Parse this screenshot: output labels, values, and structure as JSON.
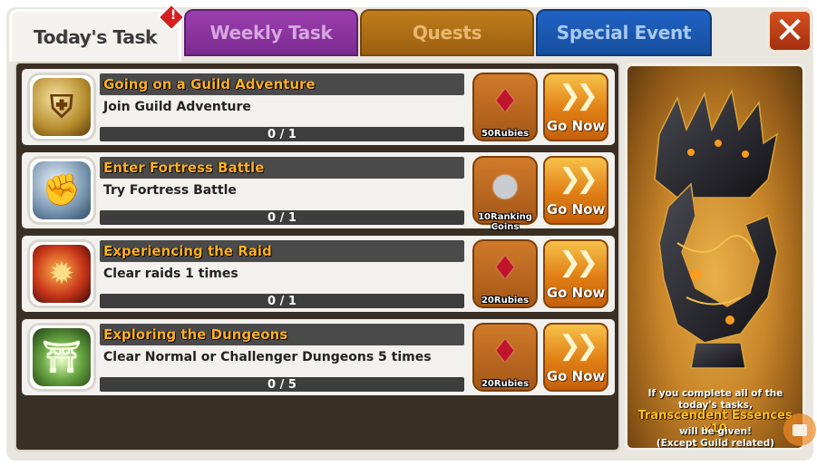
{
  "tabs": {
    "today": "Today's Task",
    "weekly": "Weekly Task",
    "quests": "Quests",
    "special": "Special Event"
  },
  "alert_badge": "!",
  "close_label": "✕",
  "tasks": [
    {
      "title": "Going on a Guild Adventure",
      "description": "Join Guild Adventure",
      "progress": "0 / 1",
      "reward_label": "50Rubies",
      "reward_icon": "ruby-icon",
      "task_icon": "guild-emblem-icon",
      "button_label": "Go Now"
    },
    {
      "title": "Enter Fortress Battle",
      "description": "Try Fortress Battle",
      "progress": "0 / 1",
      "reward_label": "10Ranking Coins",
      "reward_icon": "ranking-coin-icon",
      "task_icon": "fist-icon",
      "button_label": "Go Now"
    },
    {
      "title": "Experiencing the Raid",
      "description": "Clear raids 1 times",
      "progress": "0 / 1",
      "reward_label": "20Rubies",
      "reward_icon": "ruby-icon",
      "task_icon": "dragon-icon",
      "button_label": "Go Now"
    },
    {
      "title": "Exploring the Dungeons",
      "description": "Clear Normal or Challenger Dungeons 5 times",
      "progress": "0 / 5",
      "reward_label": "20Rubies",
      "reward_icon": "ruby-icon",
      "task_icon": "dungeon-gate-icon",
      "button_label": "Go Now"
    }
  ],
  "side_panel": {
    "line1": "If you complete all of the today's tasks,",
    "highlight": "Transcendent Essences x10",
    "line2": "will be given!",
    "line3": "(Except Guild related)"
  },
  "colors": {
    "title_text": "#ffb021",
    "tab_weekly": "#8a349f",
    "tab_quests": "#b0701a",
    "tab_special": "#1c5bb5",
    "close_button": "#c0441a"
  }
}
